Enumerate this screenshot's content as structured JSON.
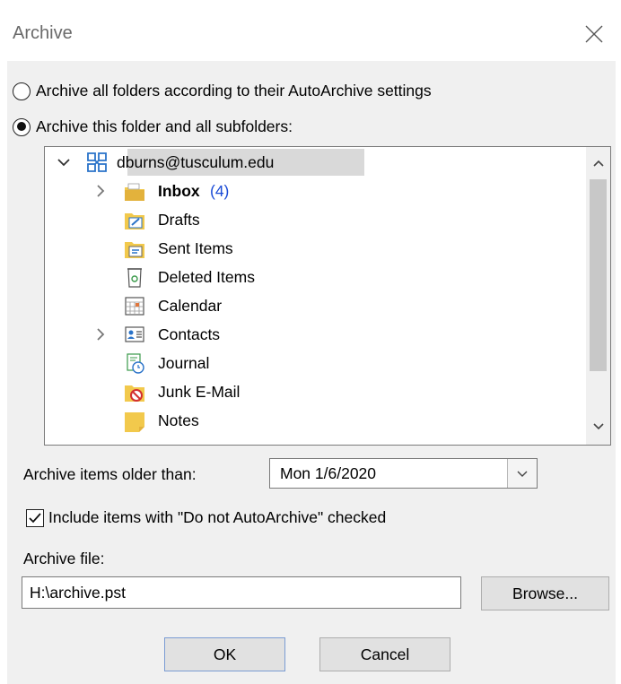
{
  "window": {
    "title": "Archive"
  },
  "options": {
    "archive_all_label": "Archive all folders according to their AutoArchive settings",
    "archive_this_label": "Archive this folder and all subfolders:",
    "selected": "archive_this"
  },
  "tree": {
    "account": "dburns@tusculum.edu",
    "folders": [
      {
        "name": "Inbox",
        "count": "(4)",
        "bold": true,
        "expandable": true,
        "icon": "inbox-icon"
      },
      {
        "name": "Drafts",
        "icon": "drafts-icon"
      },
      {
        "name": "Sent Items",
        "icon": "sent-items-icon"
      },
      {
        "name": "Deleted Items",
        "icon": "deleted-items-icon"
      },
      {
        "name": "Calendar",
        "icon": "calendar-icon"
      },
      {
        "name": "Contacts",
        "expandable": true,
        "icon": "contacts-icon"
      },
      {
        "name": "Journal",
        "icon": "journal-icon"
      },
      {
        "name": "Junk E-Mail",
        "icon": "junk-email-icon"
      },
      {
        "name": "Notes",
        "icon": "notes-icon"
      }
    ]
  },
  "archive_older": {
    "label": "Archive items older than:",
    "value": "Mon 1/6/2020"
  },
  "include_do_not": {
    "label": "Include items with \"Do not AutoArchive\" checked",
    "checked": true
  },
  "archive_file": {
    "label": "Archive file:",
    "value": "H:\\archive.pst"
  },
  "buttons": {
    "browse": "Browse...",
    "ok": "OK",
    "cancel": "Cancel"
  },
  "colors": {
    "accent": "#1a4bd6",
    "selection": "#d9d9d9",
    "dialog_bg": "#f0f0f0"
  }
}
